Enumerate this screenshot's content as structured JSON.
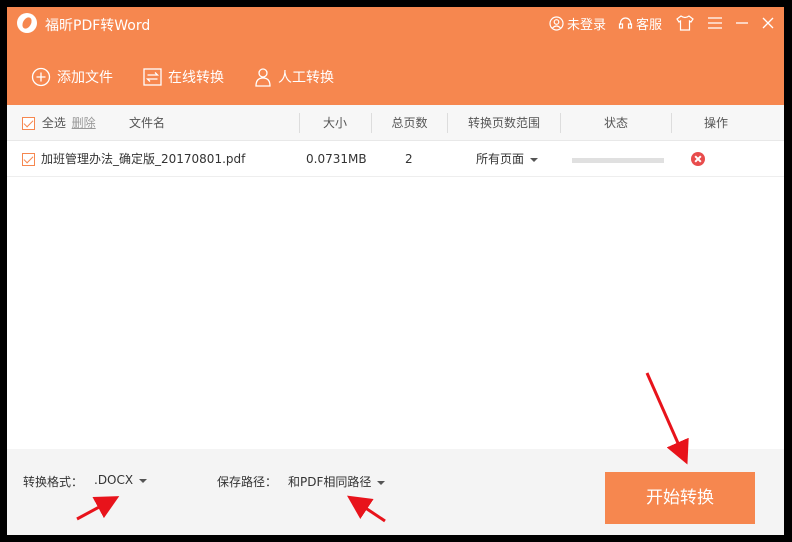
{
  "app": {
    "title": "福昕PDF转Word"
  },
  "top_right": {
    "login_label": "未登录",
    "service_label": "客服"
  },
  "toolbar": {
    "add_file": "添加文件",
    "online_convert": "在线转换",
    "manual_convert": "人工转换"
  },
  "table": {
    "select_all": "全选",
    "delete": "删除",
    "columns": [
      "文件名",
      "大小",
      "总页数",
      "转换页数范围",
      "状态",
      "操作"
    ],
    "rows": [
      {
        "name": "加班管理办法_确定版_20170801.pdf",
        "size": "0.0731MB",
        "pages": "2",
        "range": "所有页面",
        "progress": 0
      }
    ]
  },
  "footer": {
    "format_label": "转换格式：",
    "format_value": ".DOCX",
    "path_label": "保存路径：",
    "path_value": "和PDF相同路径",
    "start_button": "开始转换"
  },
  "colors": {
    "accent": "#f6874f",
    "annotation": "#e8131b"
  }
}
